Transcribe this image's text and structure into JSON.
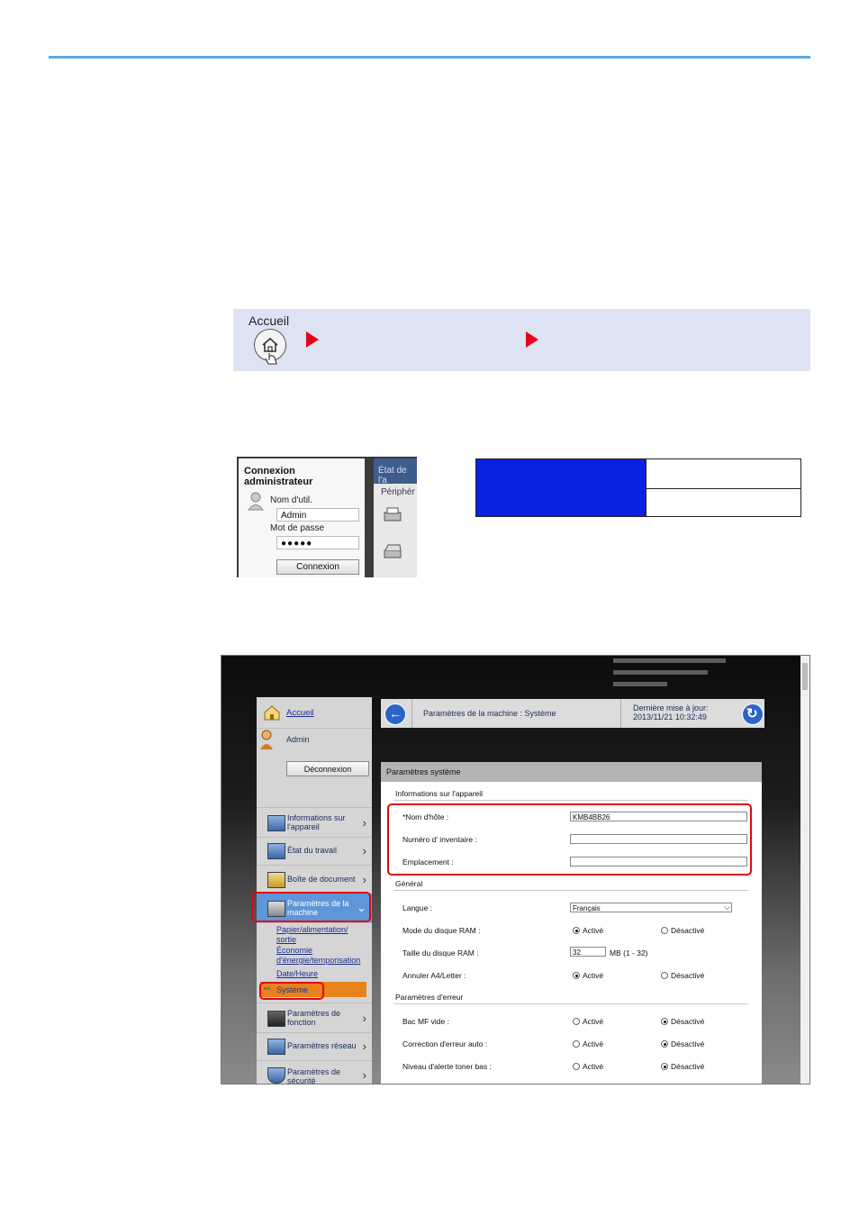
{
  "home_band": {
    "label": "Accueil"
  },
  "login": {
    "title_line1": "Connexion",
    "title_line2": "administrateur",
    "user_label": "Nom d'util.",
    "user_value": "Admin",
    "password_label": "Mot de passe",
    "password_value": "●●●●●",
    "button": "Connexion",
    "right_line1": "État de l'a",
    "right_line2": "Périphér"
  },
  "web": {
    "sidebar": {
      "home": "Accueil",
      "user": "Admin",
      "logout": "Déconnexion",
      "items": [
        {
          "l1": "Informations sur",
          "l2": "l'appareil"
        },
        {
          "l1": "État du travail",
          "l2": ""
        },
        {
          "l1": "Boîte de document",
          "l2": ""
        },
        {
          "l1": "Paramètres de la",
          "l2": "machine"
        },
        {
          "l1": "Paramètres de",
          "l2": "fonction"
        },
        {
          "l1": "Paramètres réseau",
          "l2": ""
        },
        {
          "l1": "Paramètres de",
          "l2": "sécurité"
        }
      ],
      "sub": {
        "paper1": "Papier/alimentation/",
        "paper2": "sortie",
        "eco1": "Économie",
        "eco2": "d'énergie/temporisation",
        "date": "Date/Heure",
        "system": "Système"
      }
    },
    "header": {
      "title": "Paramètres de la machine : Système",
      "update_label": "Dernière mise à jour:",
      "update_value": "2013/11/21 10:32:49"
    },
    "panel": {
      "title": "Paramètres système",
      "sec_device": "Informations sur l'appareil",
      "host_label": "*Nom d'hôte :",
      "host_value": "KMB4BB26",
      "asset_label": "Numéro d' inventaire :",
      "location_label": "Emplacement :",
      "sec_general": "Général",
      "lang_label": "Langue :",
      "lang_value": "Français",
      "ram_mode_label": "Mode du disque RAM :",
      "ram_size_label": "Taille du disque RAM :",
      "ram_size_value": "32",
      "ram_size_unit": "MB (1 - 32)",
      "a4_label": "Annuler A4/Letter :",
      "sec_error": "Paramètres d'erreur",
      "mf_label": "Bac MF vide :",
      "autoerr_label": "Correction d'erreur auto :",
      "toner_label": "Niveau d'alerte toner bas :",
      "on": "Activé",
      "off": "Désactivé"
    }
  }
}
